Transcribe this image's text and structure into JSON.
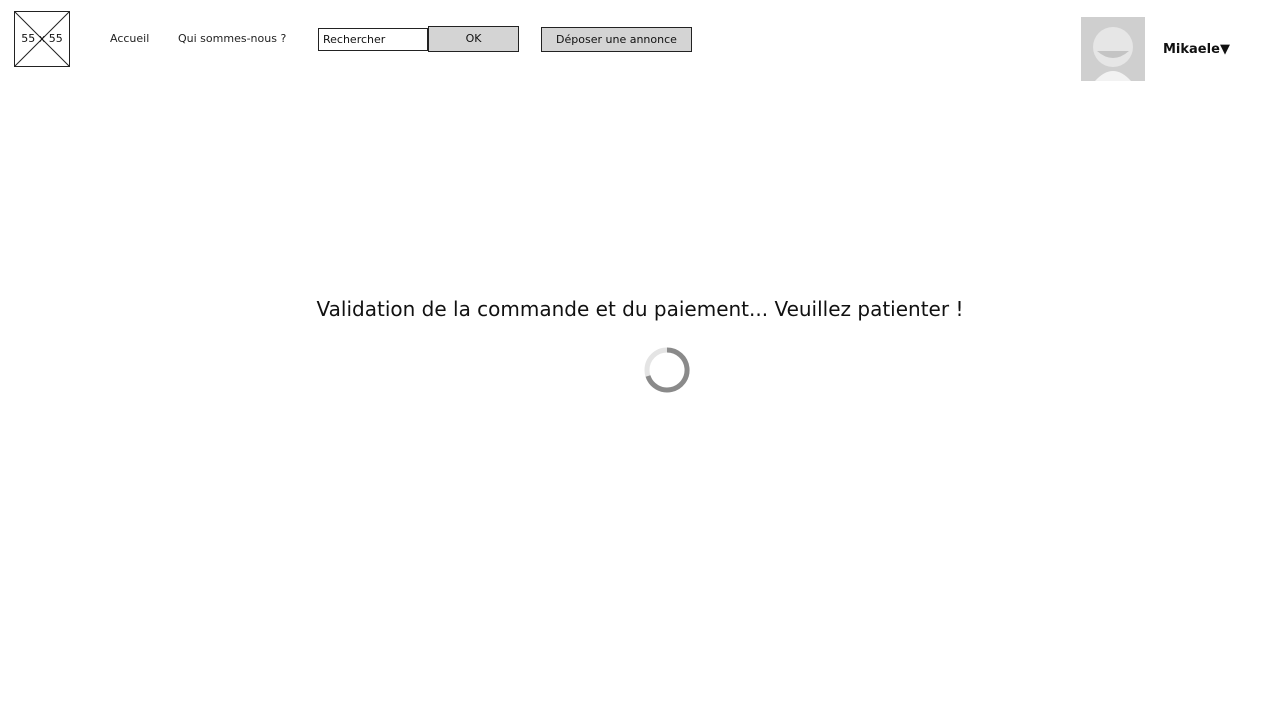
{
  "header": {
    "logo_placeholder": "55 x 55",
    "nav": {
      "home": "Accueil",
      "about": "Qui sommes-nous ?"
    },
    "search": {
      "value": "Rechercher",
      "button_label": "OK"
    },
    "post_ad_label": "Déposer une annonce",
    "user": {
      "name": "Mikaele",
      "menu_icon": "triangle-down",
      "caret": "▼"
    }
  },
  "main": {
    "status_message": "Validation de la commande et du paiement... Veuillez patienter !",
    "loading_icon": "spinner"
  },
  "colors": {
    "button_background": "#d4d4d4",
    "avatar_background": "#cfcfcf",
    "spinner": "#8a8a8a"
  }
}
